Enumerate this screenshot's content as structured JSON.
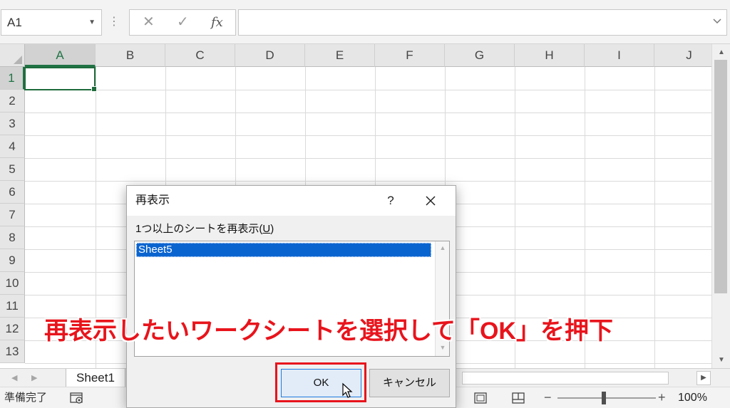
{
  "formula_bar": {
    "name_box_value": "A1",
    "cancel_icon": "✕",
    "enter_icon": "✓",
    "fx_label": "fx",
    "formula_value": ""
  },
  "grid": {
    "columns": [
      "A",
      "B",
      "C",
      "D",
      "E",
      "F",
      "G",
      "H",
      "I",
      "J"
    ],
    "rows": [
      "1",
      "2",
      "3",
      "4",
      "5",
      "6",
      "7",
      "8",
      "9",
      "10",
      "11",
      "12",
      "13"
    ],
    "selected_cell": "A1"
  },
  "sheet_tabs": {
    "prev_icon": "◀",
    "next_icon": "▶",
    "tabs": [
      {
        "label": "Sheet1"
      }
    ]
  },
  "status_bar": {
    "status_text": "準備完了",
    "zoom_minus": "−",
    "zoom_plus": "+",
    "zoom_percent": "100%"
  },
  "dialog": {
    "title": "再表示",
    "help_label": "?",
    "list_label_prefix": "1つ以上のシートを再表示(",
    "list_label_accel": "U",
    "list_label_suffix": ")",
    "list_items": [
      "Sheet5"
    ],
    "ok_label": "OK",
    "cancel_label": "キャンセル"
  },
  "annotation": {
    "caption": "再表示したいワークシートを選択して「OK」を押下",
    "color": "#e8141c"
  }
}
